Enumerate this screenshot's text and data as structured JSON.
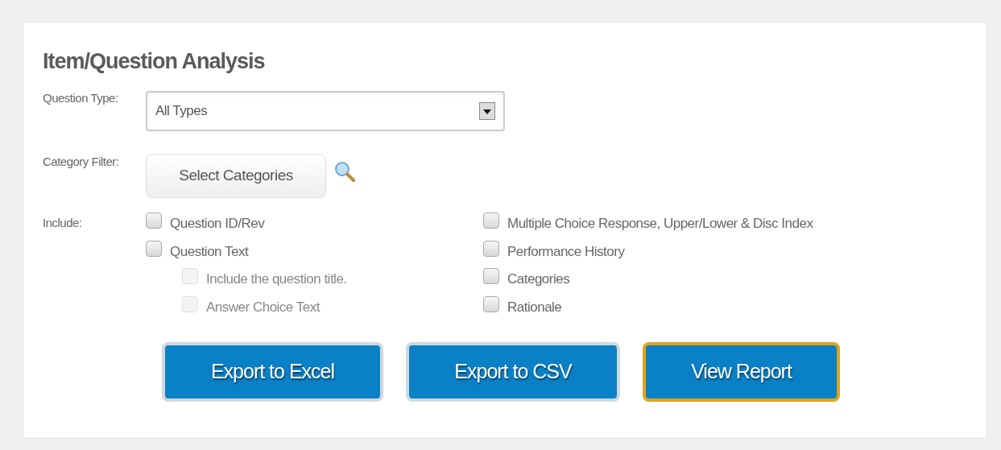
{
  "title": "Item/Question Analysis",
  "question_type": {
    "label": "Question Type:",
    "value": "All Types"
  },
  "category_filter": {
    "label": "Category Filter:",
    "button": "Select Categories"
  },
  "include": {
    "label": "Include:",
    "left": [
      {
        "label": "Question ID/Rev",
        "checked": false,
        "disabled": false
      },
      {
        "label": "Question Text",
        "checked": false,
        "disabled": false,
        "children": [
          {
            "label": "Include the question title.",
            "checked": false,
            "disabled": true
          },
          {
            "label": "Answer Choice Text",
            "checked": false,
            "disabled": true
          }
        ]
      }
    ],
    "right": [
      {
        "label": "Multiple Choice Response, Upper/Lower & Disc Index",
        "checked": false,
        "disabled": false
      },
      {
        "label": "Performance History",
        "checked": false,
        "disabled": false
      },
      {
        "label": "Categories",
        "checked": false,
        "disabled": false
      },
      {
        "label": "Rationale",
        "checked": false,
        "disabled": false
      }
    ]
  },
  "buttons": [
    {
      "label": "Export to Excel",
      "focused": false
    },
    {
      "label": "Export to CSV",
      "focused": false
    },
    {
      "label": "View Report",
      "focused": true
    }
  ]
}
